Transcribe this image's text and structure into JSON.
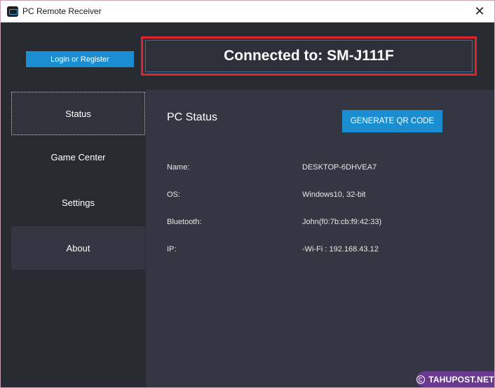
{
  "window": {
    "title": "PC Remote Receiver",
    "close_glyph": "✕"
  },
  "header": {
    "login_label": "Login or Register",
    "connected_label": "Connected to: SM-J111F"
  },
  "sidebar": {
    "items": [
      {
        "label": "Status",
        "active": true
      },
      {
        "label": "Game Center",
        "active": false
      },
      {
        "label": "Settings",
        "active": false
      },
      {
        "label": "About",
        "active": false
      }
    ]
  },
  "main": {
    "title": "PC Status",
    "qr_button_label": "GENERATE QR CODE",
    "info": [
      {
        "label": "Name:",
        "value": "DESKTOP-6DHVEA7"
      },
      {
        "label": "OS:",
        "value": "Windows10, 32-bit"
      },
      {
        "label": "Bluetooth:",
        "value": "John(f0:7b:cb:f9:42:33)"
      },
      {
        "label": "IP:",
        "value": "-Wi-Fi : 192.168.43.12"
      }
    ]
  },
  "watermark": {
    "text": "TAHUPOST.NET"
  },
  "colors": {
    "accent": "#1a8ed0",
    "highlight_border": "#e0242e",
    "panel_bg": "#343741",
    "sidebar_bg": "#272a31"
  }
}
